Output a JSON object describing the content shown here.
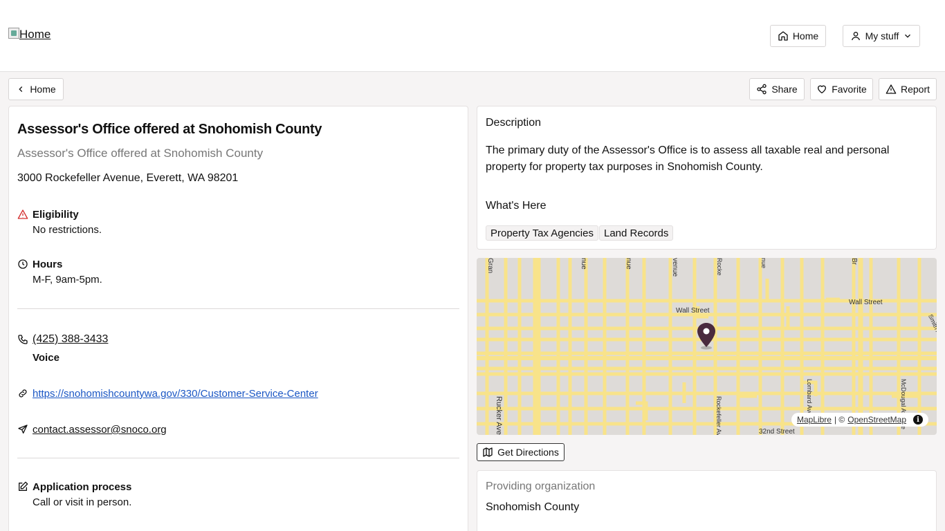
{
  "header": {
    "logo_alt": "Home",
    "home_label": "Home",
    "mystuff_label": "My stuff"
  },
  "toolbar": {
    "back_label": "Home",
    "share_label": "Share",
    "favorite_label": "Favorite",
    "report_label": "Report"
  },
  "service": {
    "title": "Assessor's Office offered at Snohomish County",
    "subtitle": "Assessor's Office offered at Snohomish County",
    "address": "3000 Rockefeller Avenue, Everett, WA 98201",
    "eligibility_label": "Eligibility",
    "eligibility_value": "No restrictions.",
    "hours_label": "Hours",
    "hours_value": "M-F, 9am-5pm.",
    "phone": "(425) 388-3433",
    "phone_type": "Voice",
    "website": "https://snohomishcountywa.gov/330/Customer-Service-Center",
    "email": "contact.assessor@snoco.org",
    "application_label": "Application process",
    "application_value": "Call or visit in person."
  },
  "description": {
    "heading": "Description",
    "text": "The primary duty of the Assessor's Office is to assess all taxable real and personal property for property tax purposes in Snohomish County.",
    "whats_here_heading": "What's Here",
    "tags": [
      "Property Tax Agencies",
      "Land Records"
    ]
  },
  "map": {
    "street_labels": [
      "Wall Street",
      "Wall Street",
      "Rucker Avenue",
      "Rockefeller Avenue",
      "Lombard Avenue",
      "McDougal Avenue",
      "32nd Street",
      "Smith Av",
      "Gran",
      "nue",
      "nue",
      "venue",
      "Rocke",
      "nue",
      "Br"
    ],
    "attribution_maplibre": "MapLibre",
    "attribution_sep": " | © ",
    "attribution_osm": "OpenStreetMap",
    "info_glyph": "i",
    "directions_label": "Get Directions",
    "road_color": "#f8e38a",
    "land_color": "#dedbd8",
    "pin_color": "#4a2a3e"
  },
  "organization": {
    "heading": "Providing organization",
    "name": "Snohomish County"
  },
  "colors": {
    "warning": "#d32f2f",
    "link": "#1a56c4"
  }
}
